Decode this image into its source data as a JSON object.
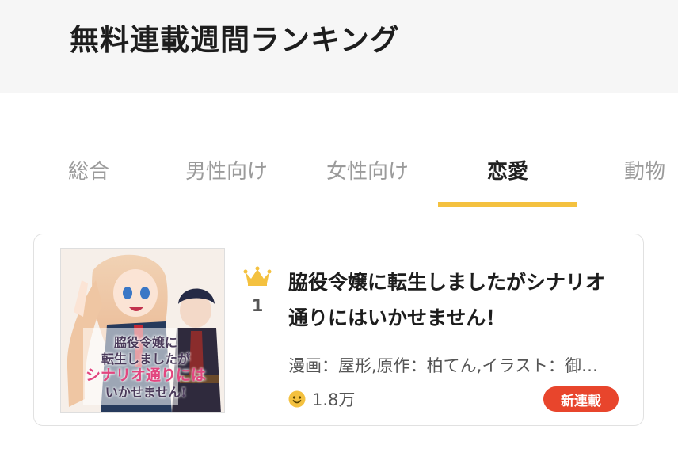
{
  "header": {
    "title": "無料連載週間ランキング"
  },
  "tabs": [
    {
      "label": "総合"
    },
    {
      "label": "男性向け"
    },
    {
      "label": "女性向け"
    },
    {
      "label": "恋愛",
      "active": true
    },
    {
      "label": "動物"
    }
  ],
  "accent_color": "#f4c13f",
  "ranking": [
    {
      "rank": "1",
      "rank_icon": "crown-icon",
      "title": "脇役令嬢に転生しましたがシナリオ通りにはいかせません！",
      "authors": "漫画：屋形,原作：柏てん,イラスト：御子柴リョウ",
      "favorites": "1.8万",
      "favorites_icon": "smile-icon",
      "badge": "新連載",
      "badge_color": "#e8452c",
      "thumbnail": {
        "cover_text_lines": [
          "脇役令嬢に",
          "転生しましたが",
          "シナリオ通りには",
          "いかせません!"
        ]
      }
    }
  ]
}
